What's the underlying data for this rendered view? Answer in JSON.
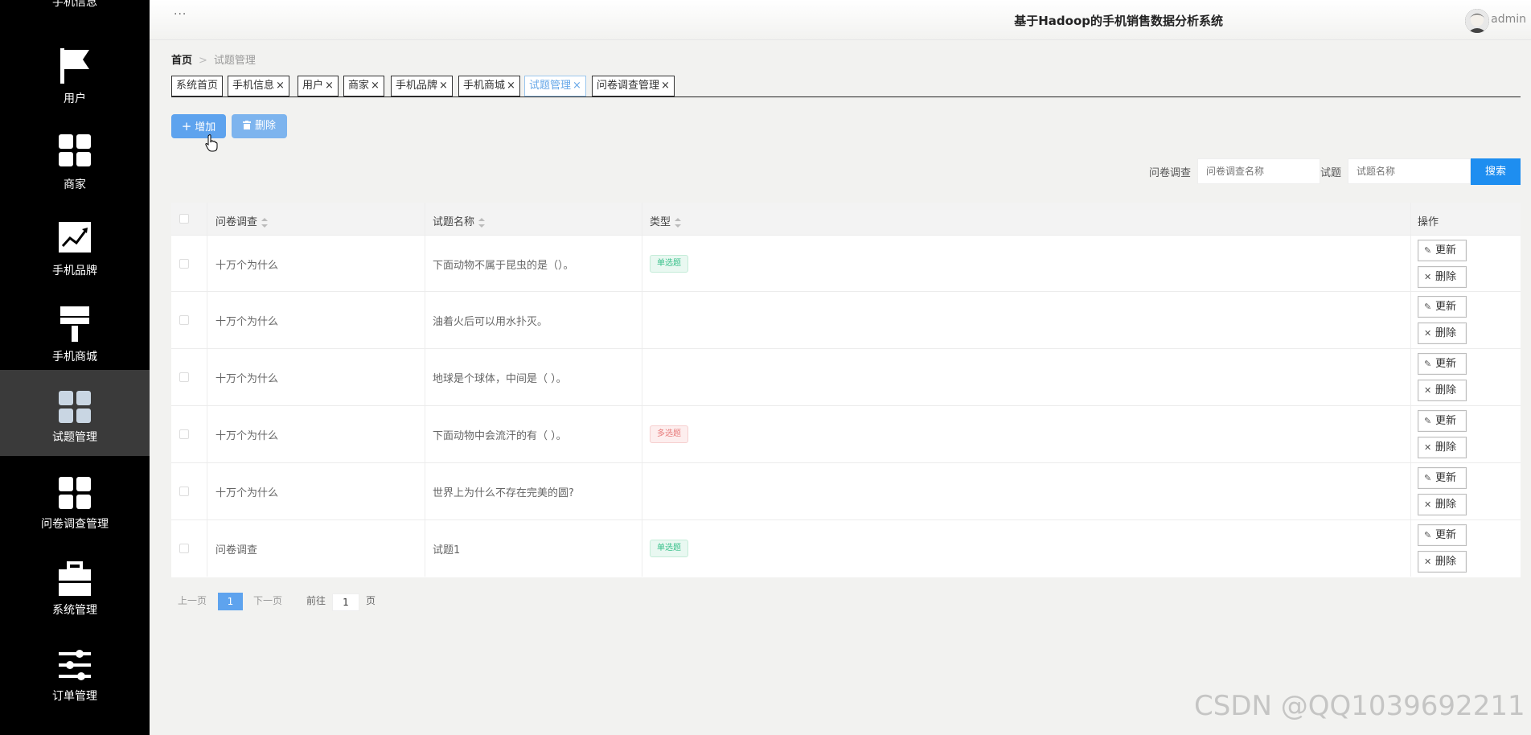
{
  "app": {
    "title": "基于Hadoop的手机销售数据分析系统",
    "username": "admin",
    "more_dots": "···"
  },
  "sidebar": {
    "cut_label": "手机信息",
    "items": [
      {
        "label": "用户",
        "icon": "flag-icon"
      },
      {
        "label": "商家",
        "icon": "grid-icon"
      },
      {
        "label": "手机品牌",
        "icon": "chart-line-icon"
      },
      {
        "label": "手机商城",
        "icon": "brush-icon"
      },
      {
        "label": "试题管理",
        "icon": "grid-icon",
        "active": true
      },
      {
        "label": "问卷调查管理",
        "icon": "grid-icon"
      },
      {
        "label": "系统管理",
        "icon": "briefcase-icon"
      },
      {
        "label": "订单管理",
        "icon": "sliders-icon"
      }
    ]
  },
  "breadcrumb": {
    "home": "首页",
    "separator": ">",
    "current": "试题管理"
  },
  "tabs": [
    {
      "label": "系统首页",
      "closable": false
    },
    {
      "label": "手机信息",
      "closable": true
    },
    {
      "label": "用户",
      "closable": true
    },
    {
      "label": "商家",
      "closable": true
    },
    {
      "label": "手机品牌",
      "closable": true
    },
    {
      "label": "手机商城",
      "closable": true
    },
    {
      "label": "试题管理",
      "closable": true,
      "active": true
    },
    {
      "label": "问卷调查管理",
      "closable": true
    }
  ],
  "tab_close": "×",
  "actions": {
    "add_label": "增加",
    "add_icon": "+",
    "delete_label": "删除",
    "delete_icon": "trash-icon"
  },
  "search": {
    "survey_label": "问卷调查",
    "survey_placeholder": "问卷调查名称",
    "question_label": "试题",
    "question_placeholder": "试题名称",
    "button_label": "搜索"
  },
  "table": {
    "columns": [
      "问卷调查",
      "试题名称",
      "类型",
      "操作"
    ],
    "rows": [
      {
        "survey": "十万个为什么",
        "question": "下面动物不属于昆虫的是（）。",
        "type": "单选题",
        "type_kind": "single"
      },
      {
        "survey": "十万个为什么",
        "question": "油着火后可以用水扑灭。",
        "type": "",
        "type_kind": ""
      },
      {
        "survey": "十万个为什么",
        "question": "地球是个球体，中间是（ ）。",
        "type": "",
        "type_kind": ""
      },
      {
        "survey": "十万个为什么",
        "question": "下面动物中会流汗的有（ ）。",
        "type": "多选题",
        "type_kind": "multi"
      },
      {
        "survey": "十万个为什么",
        "question": "世界上为什么不存在完美的圆?",
        "type": "",
        "type_kind": ""
      },
      {
        "survey": "问卷调查",
        "question": "试题1",
        "type": "单选题",
        "type_kind": "single"
      }
    ],
    "update_label": "更新",
    "delete_label": "删除"
  },
  "pagination": {
    "prev": "上一页",
    "current_page": "1",
    "next": "下一页",
    "goto_prefix": "前往",
    "goto_value": "1",
    "goto_suffix": "页"
  },
  "watermark": "CSDN @QQ1039692211",
  "colors": {
    "accent": "#1e8ef0",
    "button": "#5ea3ee",
    "sidebar": "#000000",
    "single_badge": "#38c08a",
    "multi_badge": "#e77a7a"
  }
}
